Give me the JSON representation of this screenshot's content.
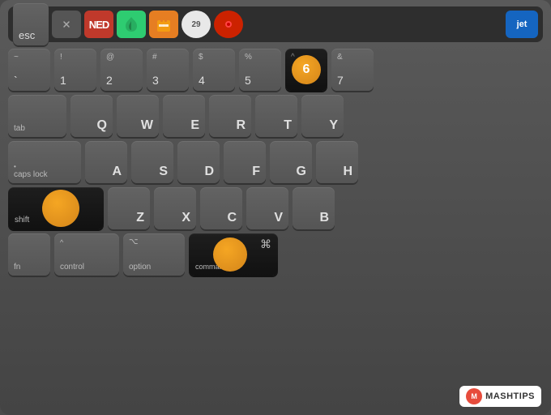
{
  "touchbar": {
    "esc_label": "esc",
    "close_icon": "✕",
    "jet_label": "jet",
    "app_icons": [
      "✕",
      "N",
      "🌿",
      "🍺",
      "29",
      "●"
    ]
  },
  "rows": {
    "number_row": [
      {
        "top": "~",
        "bot": "`"
      },
      {
        "top": "!",
        "bot": "1"
      },
      {
        "top": "@",
        "bot": "2"
      },
      {
        "top": "#",
        "bot": "3"
      },
      {
        "top": "$",
        "bot": "4"
      },
      {
        "top": "%",
        "bot": "5"
      },
      {
        "top": "^",
        "bot": "6",
        "highlight": true,
        "orange_dot": true,
        "dot_number": "6"
      },
      {
        "top": "&",
        "bot": "7"
      }
    ],
    "top_row": [
      "Q",
      "W",
      "E",
      "R",
      "T",
      "Y"
    ],
    "home_row": [
      "A",
      "S",
      "D",
      "F",
      "G",
      "H"
    ],
    "bottom_row": [
      "Z",
      "X",
      "C",
      "V",
      "B"
    ],
    "fn_row": {
      "fn": "fn",
      "control": "control",
      "option": "option",
      "command": "command"
    }
  },
  "labels": {
    "tab": "tab",
    "caps_lock": "caps lock",
    "shift": "shift",
    "fn": "fn",
    "control": "control",
    "option": "option",
    "command": "command",
    "caret": "^",
    "opt_symbol": "⌥",
    "cmd_symbol": "⌘"
  },
  "colors": {
    "orange": "#f5a623",
    "key_bg": "#5a5a5a",
    "key_dark": "#1e1e1e",
    "keyboard_bg": "#4d4d4d"
  },
  "logo": {
    "m_icon": "M",
    "brand": "MASHTIPS"
  }
}
